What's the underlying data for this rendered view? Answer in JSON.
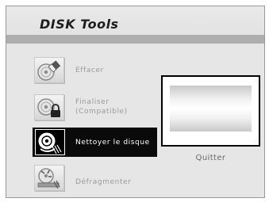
{
  "title": "DISK Tools",
  "menu": {
    "items": [
      {
        "label": "Effacer",
        "icon": "erase-disc-icon",
        "selected": false
      },
      {
        "label": "Finaliser\n(Compatible)",
        "icon": "finalize-disc-icon",
        "selected": false
      },
      {
        "label": "Nettoyer le disque",
        "icon": "clean-disc-icon",
        "selected": true
      },
      {
        "label": "Défragmenter",
        "icon": "defragment-icon",
        "selected": false
      }
    ]
  },
  "preview": {
    "caption": "Quitter"
  },
  "colors": {
    "background": "#e6e6e6",
    "title_stripe": "#aeaeae",
    "selected_bg": "#0a0a0a",
    "label_text": "#9a9a9a",
    "selected_text": "#ffffff"
  }
}
